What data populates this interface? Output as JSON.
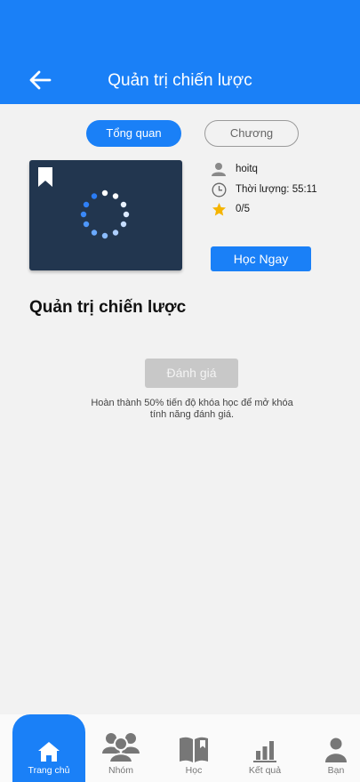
{
  "header": {
    "title": "Quản trị chiến lược"
  },
  "tabs": {
    "overview": "Tổng quan",
    "chapters": "Chương"
  },
  "course": {
    "author": "hoitq",
    "duration": "Thời lượng: 55:11",
    "rating": "0/5",
    "start_label": "Học Ngay",
    "title": "Quản trị chiến lược"
  },
  "review": {
    "button_label": "Đánh giá",
    "note": "Hoàn thành 50% tiến độ khóa học để mở khóa tính năng đánh giá."
  },
  "nav": {
    "home": "Trang chủ",
    "groups": "Nhóm",
    "learn": "Học",
    "results": "Kết quả",
    "me": "Bạn"
  },
  "colors": {
    "primary": "#1a80f7",
    "thumbnail": "#22364f",
    "disabled": "#c8c8c8"
  }
}
